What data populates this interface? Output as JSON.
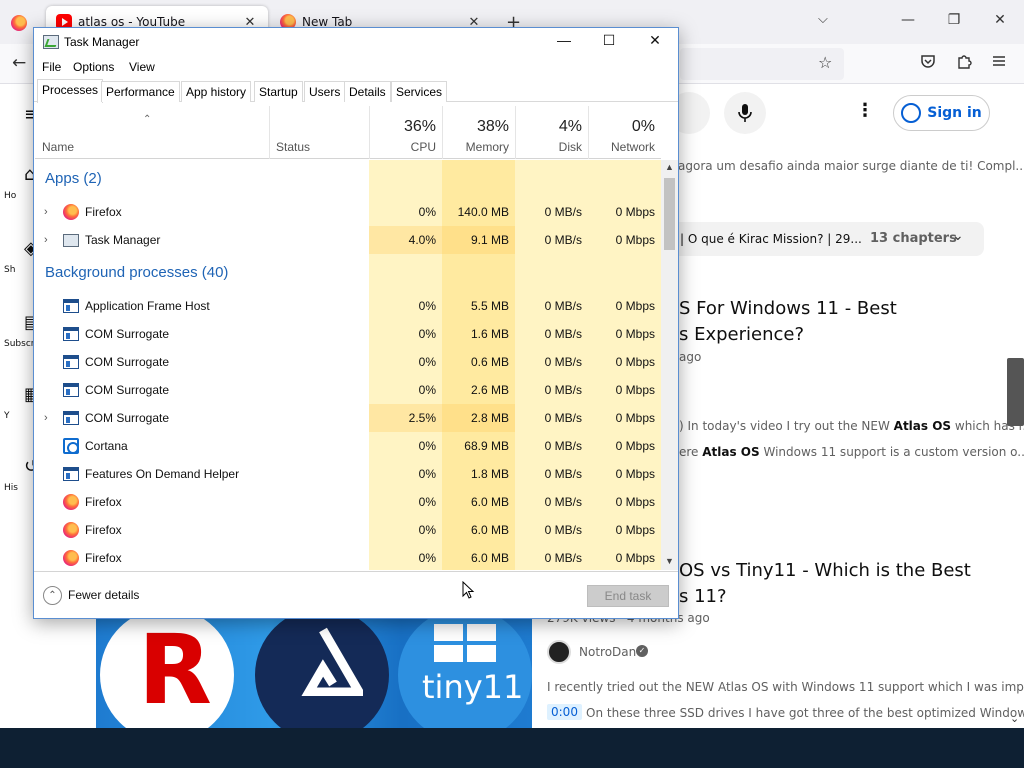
{
  "browser": {
    "tabs": [
      {
        "title": "atlas os - YouTube",
        "close": "✕"
      },
      {
        "title": "New Tab",
        "close": "✕"
      }
    ],
    "newtab": "+",
    "tablist": "⌵",
    "minimize": "—",
    "restore": "❐",
    "close": "✕",
    "back": "←",
    "bookmark": "☆",
    "toolbar_icons": [
      "pocket-icon",
      "extensions-icon",
      "menu-icon"
    ]
  },
  "youtube": {
    "signin": "Sign in",
    "mic": "🎤",
    "kebab": "⋮",
    "left_items": [
      "Ho",
      "Sh",
      "Subscr",
      "Y",
      "His"
    ],
    "snippet_top": "agora um desafio ainda maior surge diante de ti! Compl...",
    "chapters_title": "| O que é Kirac Mission? | 29...",
    "chapters_count": "13 chapters",
    "video1_title_line1": "S For Windows 11 - Best",
    "video1_title_line2": "s Experience?",
    "video1_meta": "ago",
    "video1_desc1_pre": ") In today's video I try out the NEW ",
    "video1_desc1_bold": "Atlas OS",
    "video1_desc1_post": " which has r...",
    "video1_desc2_pre": "ere ",
    "video1_desc2_bold": "Atlas OS",
    "video1_desc2_post": " Windows 11 support is a custom version o...",
    "video2_title_line1": "OS vs Tiny11 - Which is the Best",
    "video2_title_line2": "s 11?",
    "video2_meta": "279K views · 4 months ago",
    "channel": "NotroDan",
    "video2_desc": "I recently tried out the NEW Atlas OS with Windows 11 support which I was impr...",
    "timestamp": "0:00",
    "timestamp_desc": "On these three SSD drives I have got three of the best optimized Window...",
    "thumb_letter": "R",
    "thumb_text": "tiny11"
  },
  "taskmanager": {
    "title": "Task Manager",
    "menu": [
      "File",
      "Options",
      "View"
    ],
    "tabs": [
      "Processes",
      "Performance",
      "App history",
      "Startup",
      "Users",
      "Details",
      "Services"
    ],
    "columns": {
      "name": "Name",
      "status": "Status",
      "cpu": {
        "pct": "36%",
        "label": "CPU"
      },
      "memory": {
        "pct": "38%",
        "label": "Memory"
      },
      "disk": {
        "pct": "4%",
        "label": "Disk"
      },
      "network": {
        "pct": "0%",
        "label": "Network"
      }
    },
    "groups": {
      "apps": "Apps (2)",
      "background": "Background processes (40)"
    },
    "apps": [
      {
        "name": "Firefox",
        "cpu": "0%",
        "mem": "140.0 MB",
        "disk": "0 MB/s",
        "net": "0 Mbps"
      },
      {
        "name": "Task Manager",
        "cpu": "4.0%",
        "mem": "9.1 MB",
        "disk": "0 MB/s",
        "net": "0 Mbps"
      }
    ],
    "background": [
      {
        "name": "Application Frame Host",
        "cpu": "0%",
        "mem": "5.5 MB",
        "disk": "0 MB/s",
        "net": "0 Mbps"
      },
      {
        "name": "COM Surrogate",
        "cpu": "0%",
        "mem": "1.6 MB",
        "disk": "0 MB/s",
        "net": "0 Mbps"
      },
      {
        "name": "COM Surrogate",
        "cpu": "0%",
        "mem": "0.6 MB",
        "disk": "0 MB/s",
        "net": "0 Mbps"
      },
      {
        "name": "COM Surrogate",
        "cpu": "0%",
        "mem": "2.6 MB",
        "disk": "0 MB/s",
        "net": "0 Mbps"
      },
      {
        "name": "COM Surrogate",
        "cpu": "2.5%",
        "mem": "2.8 MB",
        "disk": "0 MB/s",
        "net": "0 Mbps"
      },
      {
        "name": "Cortana",
        "cpu": "0%",
        "mem": "68.9 MB",
        "disk": "0 MB/s",
        "net": "0 Mbps"
      },
      {
        "name": "Features On Demand Helper",
        "cpu": "0%",
        "mem": "1.8 MB",
        "disk": "0 MB/s",
        "net": "0 Mbps"
      },
      {
        "name": "Firefox",
        "cpu": "0%",
        "mem": "6.0 MB",
        "disk": "0 MB/s",
        "net": "0 Mbps"
      },
      {
        "name": "Firefox",
        "cpu": "0%",
        "mem": "6.0 MB",
        "disk": "0 MB/s",
        "net": "0 Mbps"
      },
      {
        "name": "Firefox",
        "cpu": "0%",
        "mem": "6.0 MB",
        "disk": "0 MB/s",
        "net": "0 Mbps"
      }
    ],
    "fewer_details": "Fewer details",
    "end_task": "End task",
    "colors": {
      "heat_light": "#fff4c4",
      "heat_mid": "#ffeaa0",
      "group_blue": "#1f64b5"
    }
  }
}
